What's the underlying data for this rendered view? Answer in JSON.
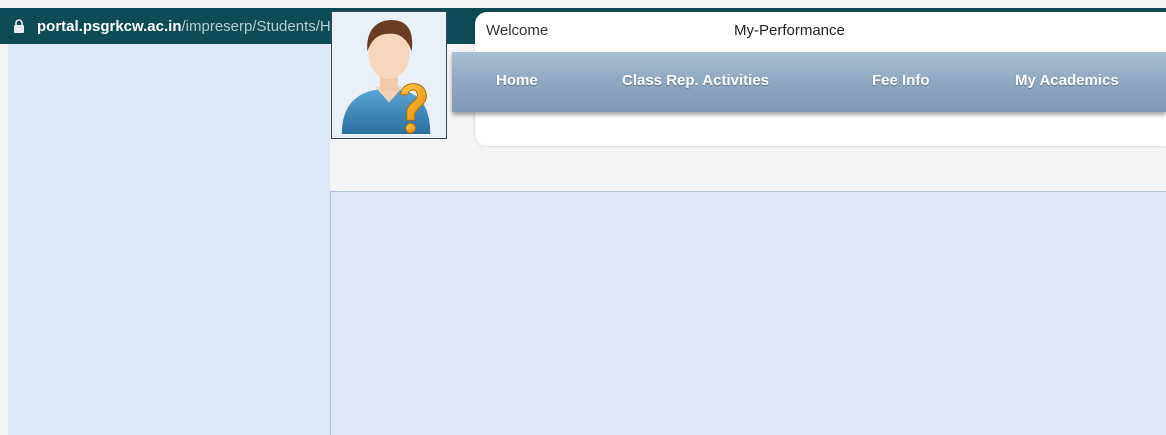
{
  "browser": {
    "url_host": "portal.psgrkcw.ac.in",
    "url_path": "/impreserp/Students/Home.aspx",
    "lock_icon": "lock-icon"
  },
  "header": {
    "welcome_text": "Welcome",
    "performance_link": "My-Performance"
  },
  "nav": {
    "items": [
      {
        "label": "Home"
      },
      {
        "label": "Class Rep. Activities"
      },
      {
        "label": "Fee Info"
      },
      {
        "label": "My Academics"
      }
    ]
  },
  "avatar": {
    "icon": "user-help-avatar-icon"
  },
  "colors": {
    "address_bar": "#0d4b56",
    "left_panel": "#dce8f6",
    "nav_bar": "#8ea8c2"
  }
}
